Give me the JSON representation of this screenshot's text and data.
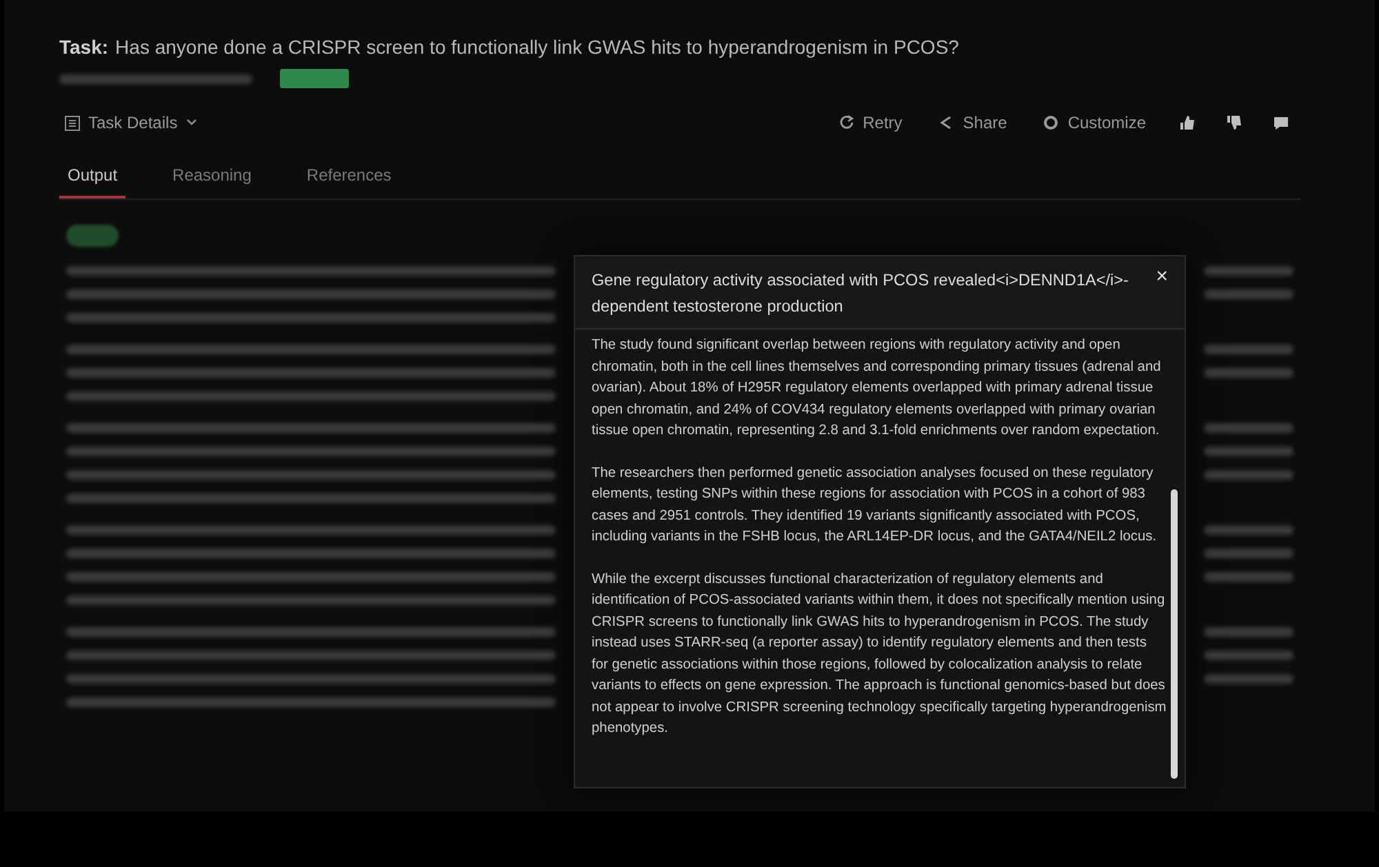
{
  "task": {
    "label": "Task:",
    "question": "Has anyone done a CRISPR screen to functionally link GWAS hits to hyperandrogenism in PCOS?"
  },
  "toolbar": {
    "task_details": "Task Details",
    "actions": [
      "Retry",
      "Share",
      "Customize"
    ]
  },
  "tabs": [
    {
      "label": "Output",
      "selected": true
    },
    {
      "label": "Reasoning",
      "selected": false
    },
    {
      "label": "References",
      "selected": false
    }
  ],
  "popup": {
    "title": "Gene regulatory activity associated with PCOS revealed<i>DENND1A</i>-dependent testosterone production",
    "close": "×",
    "paragraphs": [
      "The study found significant overlap between regions with regulatory activity and open chromatin, both in the cell lines themselves and corresponding primary tissues (adrenal and ovarian). About 18% of H295R regulatory elements overlapped with primary adrenal tissue open chromatin, and 24% of COV434 regulatory elements overlapped with primary ovarian tissue open chromatin, representing 2.8 and 3.1-fold enrichments over random expectation.",
      "The researchers then performed genetic association analyses focused on these regulatory elements, testing SNPs within these regions for association with PCOS in a cohort of 983 cases and 2951 controls. They identified 19 variants significantly associated with PCOS, including variants in the FSHB locus, the ARL14EP-DR locus, and the GATA4/NEIL2 locus.",
      "While the excerpt discusses functional characterization of regulatory elements and identification of PCOS-associated variants within them, it does not specifically mention using CRISPR screens to functionally link GWAS hits to hyperandrogenism in PCOS. The study instead uses STARR-seq (a reporter assay) to identify regulatory elements and then tests for genetic associations within those regions, followed by colocalization analysis to relate variants to effects on gene expression. The approach is functional genomics-based but does not appear to involve CRISPR screening technology specifically targeting hyperandrogenism phenotypes."
    ]
  }
}
